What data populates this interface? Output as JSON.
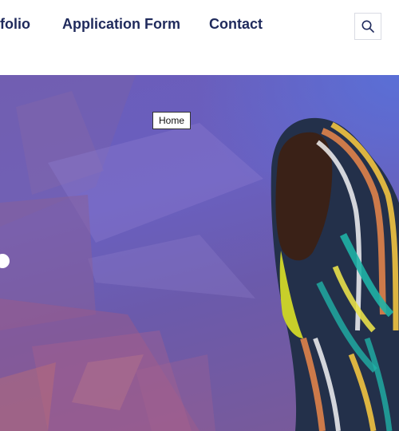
{
  "nav": {
    "items": [
      {
        "label": "tfolio"
      },
      {
        "label": "Application Form"
      },
      {
        "label": "Contact"
      }
    ],
    "search_icon": "search-icon"
  },
  "hero": {
    "tooltip": "Home"
  },
  "colors": {
    "nav_text": "#1f2a5c",
    "hero_purple": "#6b5cb9"
  }
}
